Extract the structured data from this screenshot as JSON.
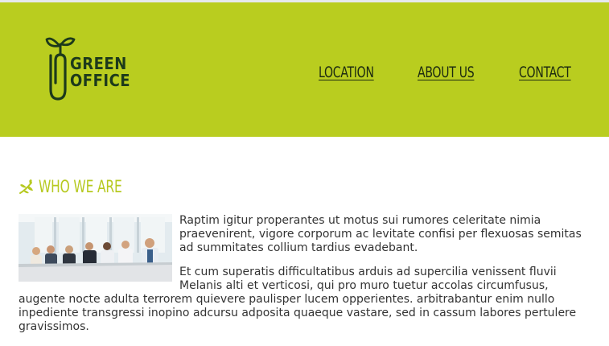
{
  "header": {
    "logo": {
      "line1": "GREEN",
      "line2": "OFFICE"
    },
    "nav": [
      {
        "label": "LOCATION"
      },
      {
        "label": "ABOUT US"
      },
      {
        "label": "CONTACT"
      }
    ],
    "background_color": "#b9cd1f"
  },
  "section": {
    "title": "WHO WE ARE",
    "title_icon": "leaf-sprig-icon",
    "accent_color": "#b6c920",
    "image_alt_icon": "team-meeting-photo",
    "paragraphs": [
      "Raptim igitur properantes ut motus sui rumores celeritate nimia praevenirent, vigore corporum ac levitate confisi per flexuosas semitas ad summitates collium tardius evadebant.",
      "Et cum superatis difficultatibus arduis ad supercilia venissent fluvii Melanis alti et verticosi, qui pro muro tuetur accolas circumfusus, augente nocte adulta terrorem quievere paulisper lucem opperientes. arbitrabantur enim nullo inpediente transgressi inopino adcursu adposita quaeque vastare, sed in cassum labores pertulere gravissimos."
    ]
  }
}
